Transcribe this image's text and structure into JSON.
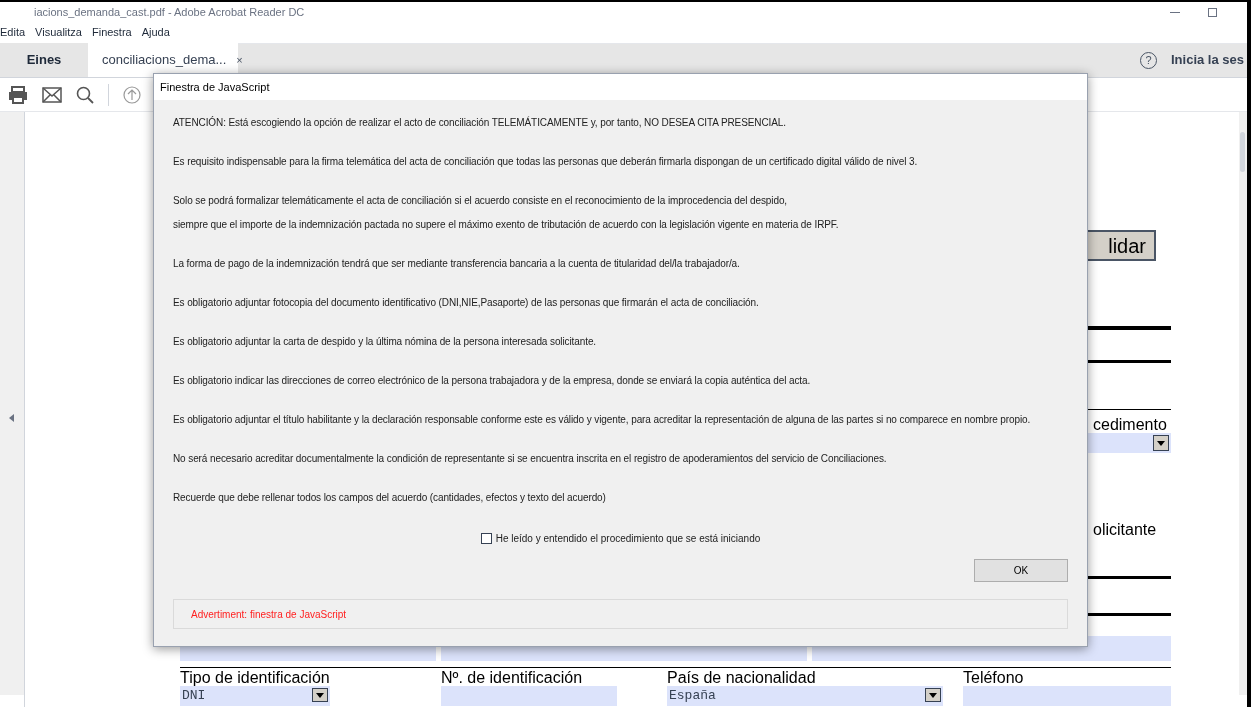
{
  "window": {
    "title": "iacions_demanda_cast.pdf - Adobe Acrobat Reader DC",
    "menu": [
      "Edita",
      "Visualitza",
      "Finestra",
      "Ajuda"
    ]
  },
  "tabs": [
    {
      "label": "Eines",
      "selected": false
    },
    {
      "label": "conciliacions_dema...",
      "selected": true,
      "close": "×"
    }
  ],
  "help_icon": "?",
  "help_label": "Inicia la ses",
  "form": {
    "button_label": "lidar",
    "label_1": "cedimento",
    "label_2": "olicitante",
    "fields": [
      {
        "label": "Tipo de identificación",
        "value": "DNI",
        "dropdown": true
      },
      {
        "label": "Nº. de identificación",
        "dropdown": false
      },
      {
        "label": "País de nacionalidad",
        "value": "España",
        "dropdown": true
      },
      {
        "label": "Teléfono",
        "dropdown": false
      }
    ]
  },
  "dialog": {
    "title": "Finestra de JavaScript",
    "paragraphs": [
      [
        "ATENCIÓN: Está escogiendo la opción de realizar el acto de conciliación TELEMÁTICAMENTE y, por tanto, NO DESEA CITA PRESENCIAL."
      ],
      [
        "Es requisito indispensable para la firma telemática del acta de conciliación que todas las personas que deberán firmarla dispongan de un certificado digital válido de nivel 3."
      ],
      [
        "Solo se podrá formalizar telemáticamente el acta de conciliación si el acuerdo consiste en el reconocimiento de la improcedencia del despido,",
        "siempre que el importe de la indemnización pactada no supere el máximo exento de tributación de acuerdo con la legislación vigente en materia de IRPF."
      ],
      [
        "La forma de pago de la indemnización tendrá que ser mediante transferencia bancaria a la cuenta de titularidad del/la trabajador/a."
      ],
      [
        "Es obligatorio adjuntar fotocopia del documento identificativo (DNI,NIE,Pasaporte) de las personas que firmarán el acta de conciliación."
      ],
      [
        "Es obligatorio adjuntar la carta de despido y la última nómina de la persona interesada solicitante."
      ],
      [
        "Es obligatorio indicar las direcciones de correo electrónico de la persona trabajadora y de la empresa, donde se enviará la copia auténtica del acta."
      ],
      [
        "Es obligatorio adjuntar el título habilitante y la declaración responsable conforme este es válido y vigente, para acreditar la representación de alguna de las partes si no comparece en nombre propio."
      ],
      [
        "No será necesario acreditar documentalmente la condición de representante si se encuentra inscrita en el registro de apoderamientos del servicio de Conciliaciones."
      ],
      [
        "Recuerde que debe rellenar todos los campos del acuerdo (cantidades, efectos y texto del acuerdo)"
      ]
    ],
    "checkbox": {
      "label": "He leído y entendido el procedimiento que se está iniciando",
      "checked": false
    },
    "ok_label": "OK",
    "warning": "Advertiment: finestra de JavaScript"
  }
}
